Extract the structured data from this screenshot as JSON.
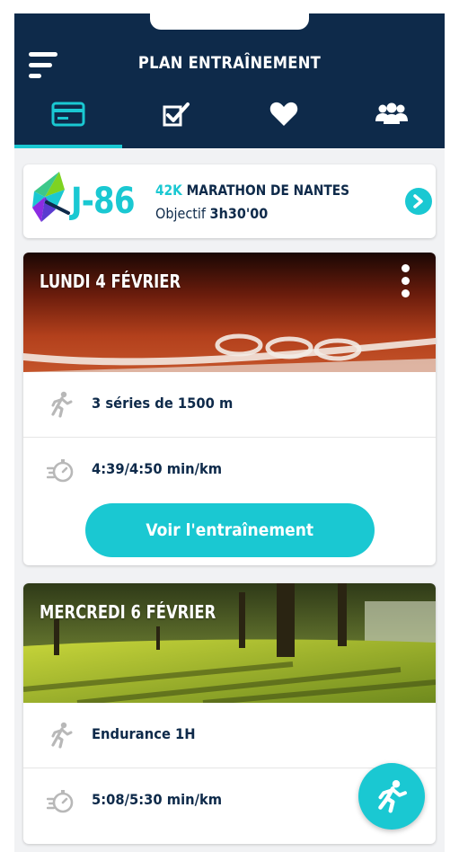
{
  "header": {
    "title": "PLAN ENTRAÎNEMENT",
    "tabs": [
      {
        "icon": "card-icon",
        "active": true
      },
      {
        "icon": "checklist-icon",
        "active": false
      },
      {
        "icon": "heart-icon",
        "active": false
      },
      {
        "icon": "group-icon",
        "active": false
      }
    ]
  },
  "countdown": {
    "days": "J-86",
    "distance": "42K",
    "race": "MARATHON DE NANTES",
    "objective_label": "Objectif",
    "objective_value": "3h30'00"
  },
  "sessions": [
    {
      "day": "LUNDI 4 FÉVRIER",
      "workout": "3 séries de 1500 m",
      "pace": "4:39/4:50 min/km",
      "button": "Voir l'entraînement"
    },
    {
      "day": "MERCREDI 6 FÉVRIER",
      "workout": "Endurance 1H",
      "pace": "5:08/5:30 min/km"
    }
  ],
  "colors": {
    "navy": "#0e2a4a",
    "accent": "#1ac8d2"
  }
}
